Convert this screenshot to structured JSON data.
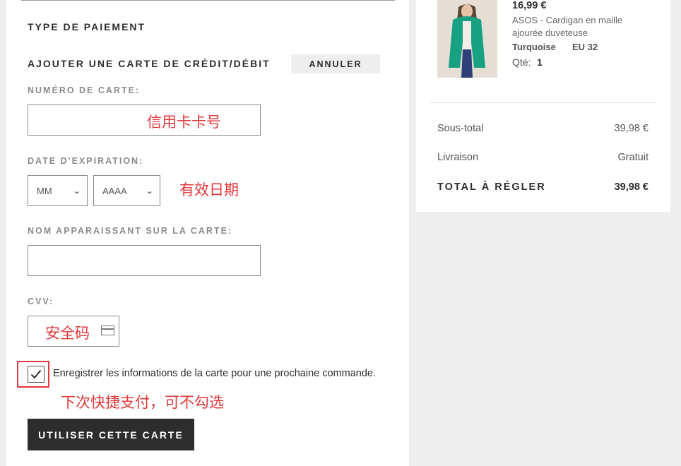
{
  "payment": {
    "section_title": "TYPE DE PAIEMENT",
    "add_card_title": "AJOUTER UNE CARTE DE CRÉDIT/DÉBIT",
    "cancel_label": "ANNULER",
    "card_number_label": "NUMÉRO DE CARTE:",
    "card_number_value": "",
    "expiry_label": "DATE D'EXPIRATION:",
    "expiry_month": "MM",
    "expiry_year": "AAAA",
    "name_label": "NOM APPARAISSANT SUR LA CARTE:",
    "name_value": "",
    "cvv_label": "CVV:",
    "cvv_value": "",
    "save_card_checked": true,
    "save_card_text": "Enregistrer les informations de la carte pour une prochaine commande.",
    "submit_label": "UTILISER CETTE CARTE"
  },
  "annotations": {
    "card_number": "信用卡卡号",
    "expiry": "有效日期",
    "cvv": "安全码",
    "save_card": "下次快捷支付，可不勾选"
  },
  "product": {
    "price": "16,99 €",
    "name_line1": "ASOS - Cardigan en maille",
    "name_line2": "ajourée duveteuse",
    "color": "Turquoise",
    "size": "EU 32",
    "qty_label": "Qté:",
    "qty": "1"
  },
  "summary": {
    "subtotal_label": "Sous-total",
    "subtotal_value": "39,98 €",
    "delivery_label": "Livraison",
    "delivery_value": "Gratuit",
    "total_label": "TOTAL À RÉGLER",
    "total_value": "39,98 €"
  },
  "colors": {
    "annotation_red": "#e0393b",
    "button_dark": "#2d2d2d",
    "page_bg": "#eeeeee"
  }
}
